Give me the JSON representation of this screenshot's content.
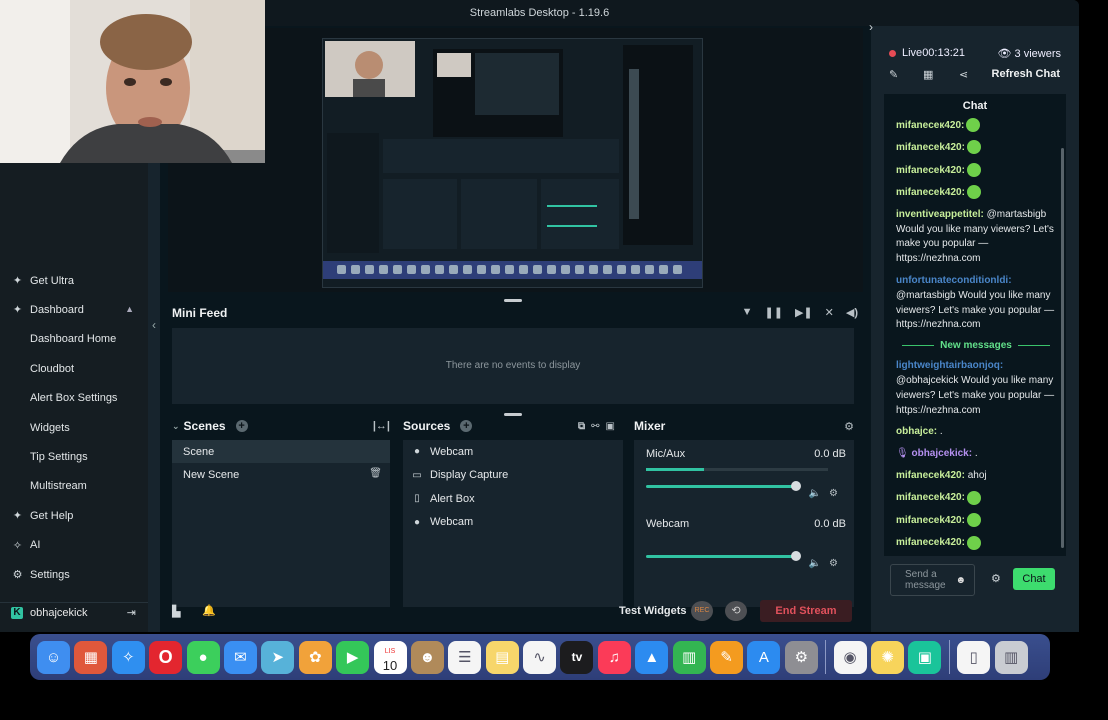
{
  "titlebar": {
    "title": "Streamlabs Desktop - 1.19.6"
  },
  "sidebar": {
    "items": [
      {
        "label": "Get Ultra",
        "icon": "ultra-icon",
        "type": "top"
      },
      {
        "label": "Dashboard",
        "icon": "dashboard-icon",
        "type": "top",
        "expanded": true
      },
      {
        "label": "Dashboard Home",
        "type": "sub"
      },
      {
        "label": "Cloudbot",
        "type": "sub"
      },
      {
        "label": "Alert Box Settings",
        "type": "sub"
      },
      {
        "label": "Widgets",
        "type": "sub"
      },
      {
        "label": "Tip Settings",
        "type": "sub"
      },
      {
        "label": "Multistream",
        "type": "sub"
      },
      {
        "label": "Get Help",
        "icon": "help-icon",
        "type": "top"
      },
      {
        "label": "AI",
        "icon": "ai-icon",
        "type": "top"
      },
      {
        "label": "Settings",
        "icon": "gear-icon",
        "type": "top"
      }
    ],
    "user": {
      "name": "obhajcekick"
    }
  },
  "minifeed": {
    "title": "Mini Feed",
    "empty_text": "There are no events to display"
  },
  "scenes": {
    "title": "Scenes",
    "items": [
      "Scene",
      "New Scene"
    ]
  },
  "sources": {
    "title": "Sources",
    "items": [
      {
        "label": "Webcam",
        "icon": "webcam-icon"
      },
      {
        "label": "Display Capture",
        "icon": "display-icon"
      },
      {
        "label": "Alert Box",
        "icon": "alert-icon"
      },
      {
        "label": "Webcam",
        "icon": "webcam-icon"
      }
    ]
  },
  "mixer": {
    "title": "Mixer",
    "channels": [
      {
        "name": "Mic/Aux",
        "level": "0.0 dB",
        "meter_fraction": 0.32,
        "volume_fraction": 1.0
      },
      {
        "name": "Webcam",
        "level": "0.0 dB",
        "meter_fraction": 0.0,
        "volume_fraction": 1.0
      }
    ]
  },
  "footer": {
    "test_widgets": "Test Widgets",
    "rec_label": "REC",
    "end_stream": "End Stream"
  },
  "chat": {
    "live_label": "Live",
    "live_time": "00:13:21",
    "viewers": "3 viewers",
    "refresh": "Refresh Chat",
    "title": "Chat",
    "messages": [
      {
        "user": "mifaneceк420:",
        "color": "green",
        "text": "",
        "emote": true
      },
      {
        "user": "mifanecek420:",
        "color": "green",
        "text": "",
        "emote": true
      },
      {
        "user": "mifanecek420:",
        "color": "green",
        "text": "",
        "emote": true
      },
      {
        "user": "mifanecek420:",
        "color": "green",
        "text": "",
        "emote": true
      },
      {
        "user": "inventiveappetitel:",
        "color": "green",
        "text": " @martasbigb Would you like many viewers? Let's make you popular — https://nezhna.com"
      },
      {
        "user": "unfortunateconditionldi:",
        "color": "blue",
        "text": " @martasbigb Would you like many viewers? Let's make you popular — https://nezhna.com"
      }
    ],
    "new_messages_label": "New messages",
    "messages_after": [
      {
        "user": "lightweightairbaonjoq:",
        "color": "blue",
        "text": " @obhajcekick Would you like many viewers? Let's make you popular — https://nezhna.com"
      },
      {
        "user": "obhajce:",
        "color": "green",
        "text": " ."
      },
      {
        "user": "obhajcekick:",
        "color": "purple",
        "text": " ."
      },
      {
        "user": "mifanecek420:",
        "color": "green",
        "text": " ahoj"
      },
      {
        "user": "mifanecek420:",
        "color": "green",
        "text": "",
        "emote": true
      },
      {
        "user": "mifanecek420:",
        "color": "green",
        "text": "",
        "emote": true
      },
      {
        "user": "mifanecek420:",
        "color": "green",
        "text": "",
        "emote": true
      }
    ],
    "input_placeholder": "Send a message",
    "send_label": "Chat"
  },
  "dock": {
    "apps": [
      {
        "name": "finder-icon",
        "color": "#3f8ef0"
      },
      {
        "name": "launchpad-icon",
        "color": "#e0583b"
      },
      {
        "name": "safari-icon",
        "color": "#2f8ff0"
      },
      {
        "name": "opera-icon",
        "color": "#e3262f"
      },
      {
        "name": "messages-icon",
        "color": "#3ccf5c"
      },
      {
        "name": "mail-icon",
        "color": "#3a8ff2"
      },
      {
        "name": "maps-icon",
        "color": "#57b2d9"
      },
      {
        "name": "photos-icon",
        "color": "#f1a23a"
      },
      {
        "name": "facetime-icon",
        "color": "#34c759"
      },
      {
        "name": "calendar-icon",
        "color": "#ffffff"
      },
      {
        "name": "contacts-icon",
        "color": "#b08a5a"
      },
      {
        "name": "reminders-icon",
        "color": "#f5f5f5"
      },
      {
        "name": "notes-icon",
        "color": "#f7d66b"
      },
      {
        "name": "freeform-icon",
        "color": "#f5f5f5"
      },
      {
        "name": "appletv-icon",
        "color": "#1c1c1e"
      },
      {
        "name": "music-icon",
        "color": "#fb3b58"
      },
      {
        "name": "keynote-icon",
        "color": "#2c8bf0"
      },
      {
        "name": "numbers-icon",
        "color": "#33b552"
      },
      {
        "name": "pages-icon",
        "color": "#f49b1f"
      },
      {
        "name": "appstore-icon",
        "color": "#2c8bf0"
      },
      {
        "name": "settings-icon",
        "color": "#8e8e93"
      },
      {
        "name": "chrome-icon",
        "color": "#f5f5f5"
      },
      {
        "name": "tips-icon",
        "color": "#f7d45b"
      },
      {
        "name": "streamlabs-icon",
        "color": "#1ac49a"
      },
      {
        "name": "file-icon",
        "color": "#f5f5f5"
      },
      {
        "name": "trash-icon",
        "color": "#c9ccd2"
      }
    ],
    "calendar_day": "10",
    "calendar_month": "LIS",
    "appletv_label": "tv"
  }
}
